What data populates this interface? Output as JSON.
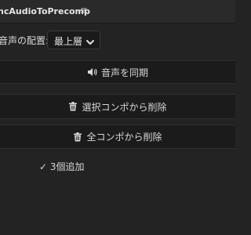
{
  "panel": {
    "title": "ncAudioToPrecomp",
    "menu_glyph": "≡"
  },
  "placement": {
    "label": "音声の配置:",
    "selected": "最上層",
    "icon": "chevron-down-icon"
  },
  "buttons": {
    "sync_label": "音声を同期",
    "sync_icon": "speaker-icon",
    "delete_selected_label": "選択コンポから削除",
    "delete_selected_icon": "trash-icon",
    "delete_all_label": "全コンポから削除",
    "delete_all_icon": "trash-icon"
  },
  "status": {
    "text": "✓ 3個追加"
  },
  "colors": {
    "background": "#232323",
    "button_background": "#1b1b1b",
    "text": "#d8d8d8"
  }
}
